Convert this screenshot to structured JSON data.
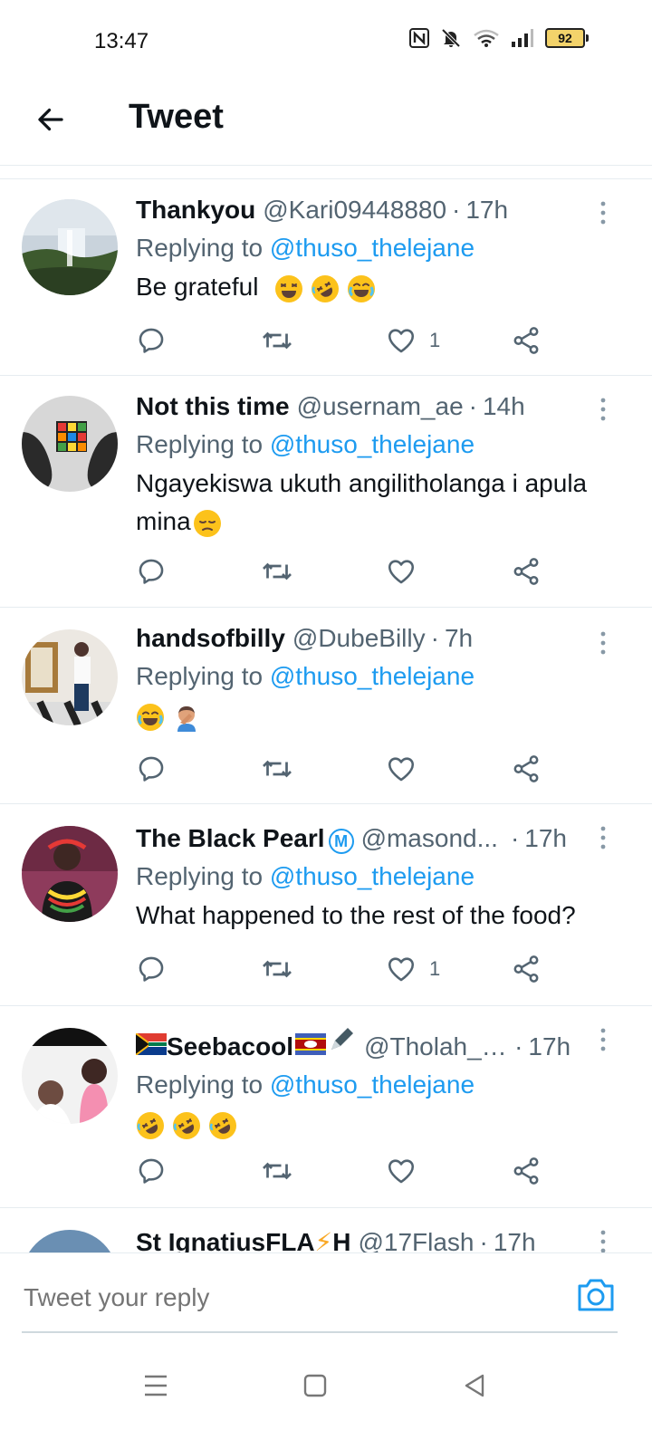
{
  "status_bar": {
    "time": "13:47",
    "battery": "92"
  },
  "header": {
    "title": "Tweet"
  },
  "tweets": [
    {
      "name": "Thankyou",
      "handle": "@Kari09448880",
      "time": "17h",
      "replying_prefix": "Replying to ",
      "replying_handle": "@thuso_thelejane",
      "text": "Be grateful",
      "likes": "1"
    },
    {
      "name": "Not this time",
      "handle": "@usernam_ae",
      "time": "14h",
      "replying_prefix": "Replying to ",
      "replying_handle": "@thuso_thelejane",
      "text": "Ngayekiswa ukuth angilitholanga i apula mina",
      "likes": ""
    },
    {
      "name": "handsofbilly",
      "handle": "@DubeBilly",
      "time": "7h",
      "replying_prefix": "Replying to ",
      "replying_handle": "@thuso_thelejane",
      "text": "",
      "likes": ""
    },
    {
      "name": "The Black Pearl",
      "verified_letter": "M",
      "handle": "@masond...",
      "time": "17h",
      "replying_prefix": "Replying to ",
      "replying_handle": "@thuso_thelejane",
      "text": "What happened to the rest of the food?",
      "likes": "1"
    },
    {
      "name": "Seebacool",
      "handle": "@Tholah_s...",
      "time": "17h",
      "replying_prefix": "Replying to ",
      "replying_handle": "@thuso_thelejane",
      "text": "",
      "likes": ""
    },
    {
      "name": "St IgnatiusFLA",
      "name_tail": "H",
      "handle": "@17Flash",
      "time": "17h"
    }
  ],
  "reply_bar": {
    "placeholder": "Tweet your reply"
  },
  "icons": {
    "back": "arrow-left-icon",
    "more": "more-vertical-icon",
    "reply": "reply-icon",
    "retweet": "retweet-icon",
    "like": "heart-icon",
    "share": "share-icon",
    "camera": "camera-icon",
    "menu": "menu-icon",
    "home": "home-icon",
    "back_nav": "back-triangle-icon"
  },
  "colors": {
    "accent": "#1d9bf0",
    "text": "#0f1419",
    "secondary": "#536471",
    "divider": "#e6ecf0"
  }
}
